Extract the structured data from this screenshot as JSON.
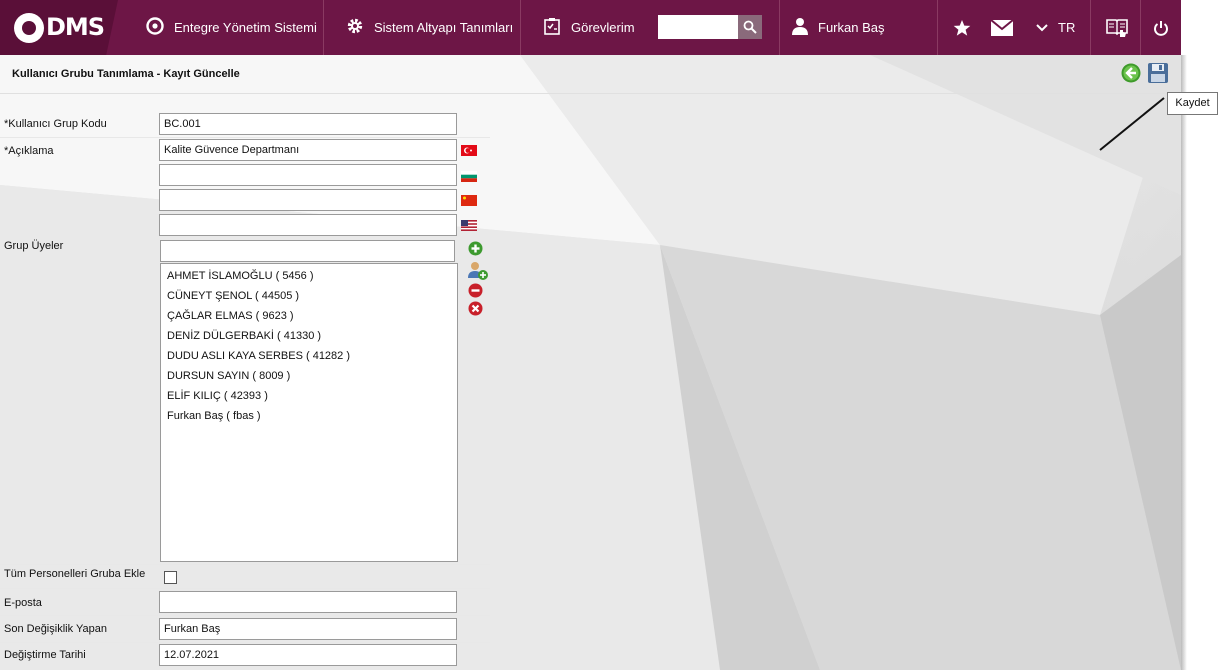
{
  "header": {
    "logo_text": "DMS",
    "nav_items": [
      {
        "label": "Entegre Yönetim Sistemi",
        "icon": "qdms-icon"
      },
      {
        "label": "Sistem Altyapı Tanımları",
        "icon": "gear-icon"
      },
      {
        "label": "Görevlerim",
        "icon": "task-icon"
      }
    ],
    "search_placeholder": "",
    "user_name": "Furkan Baş",
    "language": "TR"
  },
  "page": {
    "title": "Kullanıcı Grubu Tanımlama - Kayıt Güncelle",
    "tooltip": "Kaydet"
  },
  "form": {
    "group_code_label": "*Kullanıcı Grup Kodu",
    "group_code_value": "BC.001",
    "description_label": "*Açıklama",
    "description_tr": "Kalite Güvence Departmanı",
    "description_bg": "",
    "description_cn": "",
    "description_us": "",
    "members_label": "Grup Üyeler",
    "members_search": "",
    "members": [
      "AHMET İSLAMOĞLU ( 5456 )",
      "CÜNEYT ŞENOL ( 44505 )",
      "ÇAĞLAR ELMAS ( 9623 )",
      "DENİZ DÜLGERBAKİ ( 41330 )",
      "DUDU ASLI KAYA SERBES ( 41282 )",
      "DURSUN SAYIN ( 8009 )",
      "ELİF KILIÇ ( 42393 )",
      "Furkan Baş ( fbas )"
    ],
    "add_all_label": "Tüm Personelleri Gruba Ekle",
    "email_label": "E-posta",
    "email_value": "",
    "last_modified_by_label": "Son Değişiklik Yapan",
    "last_modified_by_value": "Furkan Baş",
    "modified_date_label": "Değiştirme Tarihi",
    "modified_date_value": "12.07.2021"
  },
  "colors": {
    "header_bg": "#6d1646",
    "logo_bg": "#5a0f38"
  }
}
